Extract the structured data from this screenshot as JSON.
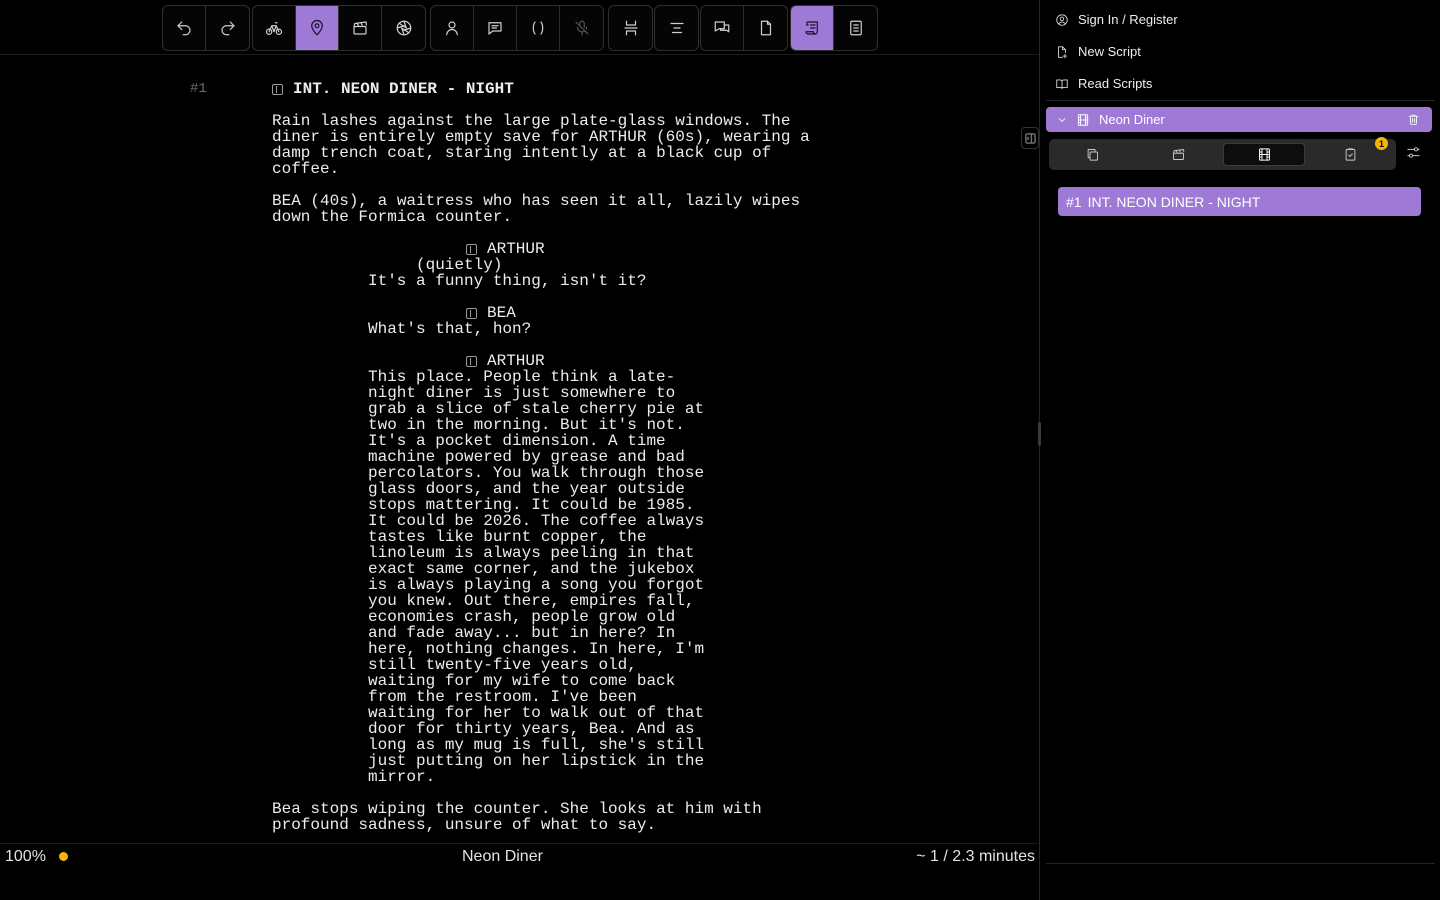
{
  "toolbar": {
    "groups": [
      [
        "undo-icon",
        "redo-icon"
      ],
      [
        "bicycle-icon",
        "location-pin-icon",
        "clapperboard-icon",
        "aperture-icon"
      ],
      [
        "person-icon",
        "speech-bubble-icon",
        "parentheses-icon",
        "microphone-off-icon"
      ],
      [
        "page-break-icon"
      ],
      [
        "align-center-icon"
      ],
      [
        "chat-bubbles-icon",
        "page-icon"
      ],
      [
        "scroll-icon",
        "script-list-icon"
      ]
    ],
    "active": [
      "location-pin-icon",
      "scroll-icon"
    ],
    "disabled": [
      "microphone-off-icon"
    ]
  },
  "script": {
    "scene_number": "#1",
    "heading": "INT. NEON DINER - NIGHT",
    "action1": "Rain lashes against the large plate-glass windows. The\ndiner is entirely empty save for ARTHUR (60s), wearing a\ndamp trench coat, staring intently at a black cup of\ncoffee.",
    "action2": "BEA (40s), a waitress who has seen it all, lazily wipes\ndown the Formica counter.",
    "char1": "ARTHUR",
    "paren1": "(quietly)",
    "dial1": "It's a funny thing, isn't it?",
    "char2": "BEA",
    "dial2": "What's that, hon?",
    "char3": "ARTHUR",
    "dial3": "This place. People think a late-\nnight diner is just somewhere to\ngrab a slice of stale cherry pie at\ntwo in the morning. But it's not.\nIt's a pocket dimension. A time\nmachine powered by grease and bad\npercolators. You walk through those\nglass doors, and the year outside\nstops mattering. It could be 1985.\nIt could be 2026. The coffee always\ntastes like burnt copper, the\nlinoleum is always peeling in that\nexact same corner, and the jukebox\nis always playing a song you forgot\nyou knew. Out there, empires fall,\neconomies crash, people grow old\nand fade away... but in here? In\nhere, nothing changes. In here, I'm\nstill twenty-five years old,\nwaiting for my wife to come back\nfrom the restroom. I've been\nwaiting for her to walk out of that\ndoor for thirty years, Bea. And as\nlong as my mug is full, she's still\njust putting on her lipstick in the\nmirror.",
    "action3": "Bea stops wiping the counter. She looks at him with\nprofound sadness, unsure of what to say."
  },
  "status": {
    "zoom": "100%",
    "title": "Neon Diner",
    "duration": "~ 1 / 2.3 minutes",
    "save_color": "#f2b50a"
  },
  "panel": {
    "sign_in": "Sign In / Register",
    "new_script": "New Script",
    "read_scripts": "Read Scripts",
    "script_title": "Neon Diner",
    "badge_count": "1",
    "scene_number": "#1",
    "scene_title": "INT. NEON DINER - NIGHT"
  },
  "colors": {
    "accent": "#9e79d6",
    "warning": "#f2b50a",
    "background": "#000000"
  }
}
